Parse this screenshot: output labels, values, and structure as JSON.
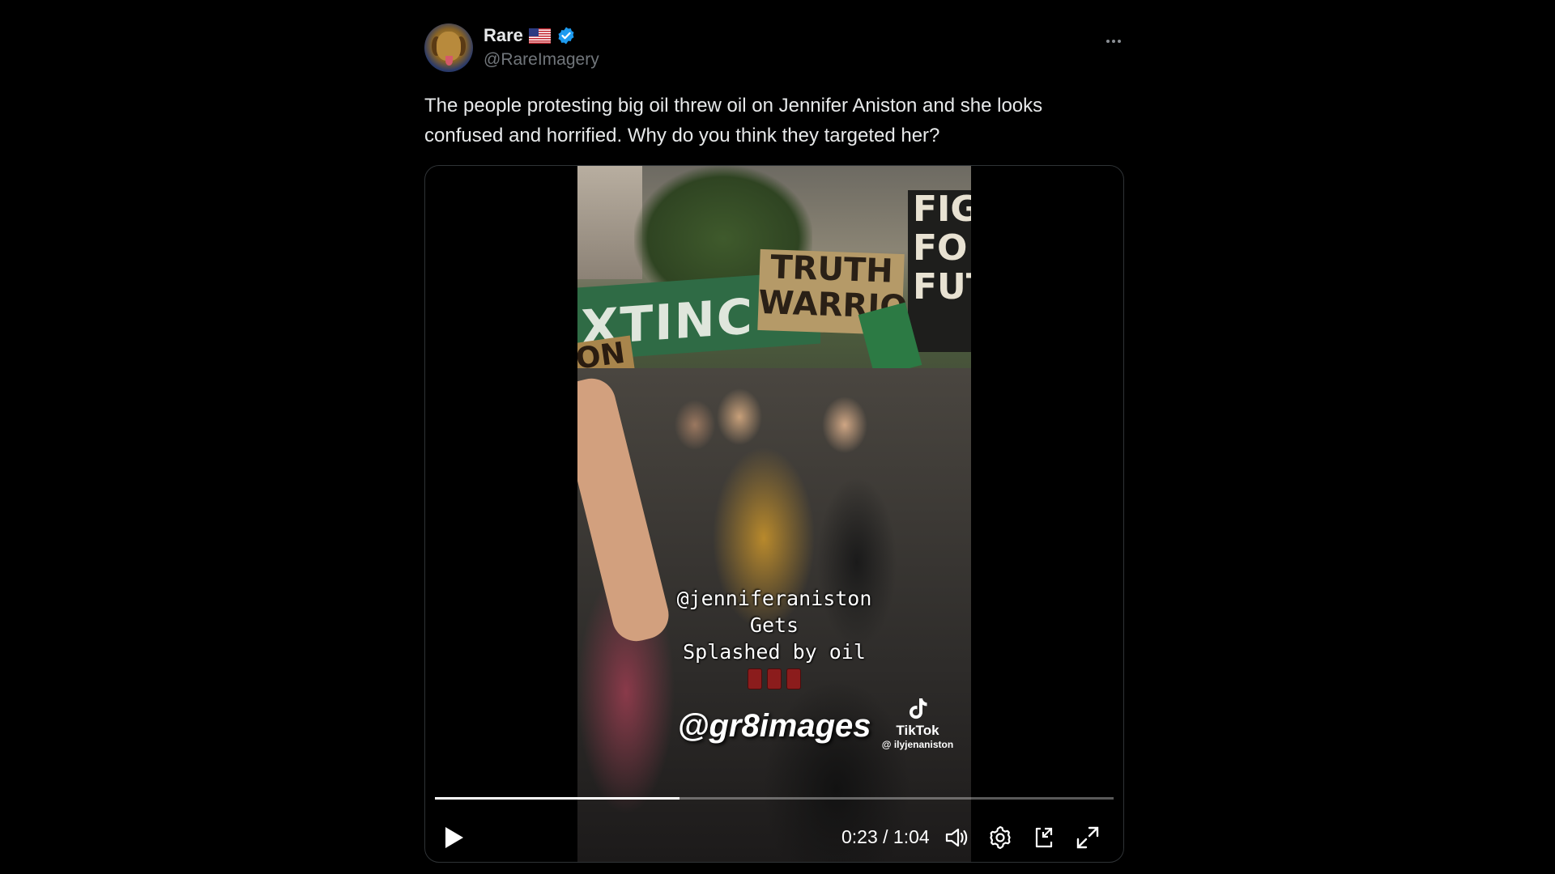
{
  "tweet": {
    "author": {
      "display_name": "Rare",
      "handle": "@RareImagery",
      "flag_icon": "us-flag-icon",
      "verified_icon": "verified-badge-icon",
      "verified_color": "#1d9bf0"
    },
    "text": "The people protesting big oil threw oil on Jennifer Aniston and she looks confused and horrified. Why do you think they targeted her?",
    "more_icon": "more-options-icon"
  },
  "video": {
    "sign_truth": "TRUTH\nWARRIO",
    "sign_fight": "FIGH\nFO\nFUT",
    "banner_text": "XTINC",
    "sign_small": "ON",
    "caption_line1": "@jenniferaniston",
    "caption_line2": "Gets",
    "caption_line3": "Splashed by oil",
    "watermark": "@gr8images",
    "tiktok_label": "TikTok",
    "tiktok_handle": "@ ilyjenaniston",
    "progress": 0.36,
    "time_display": "0:23 / 1:04"
  },
  "controls": {
    "play_icon": "play-icon",
    "volume_icon": "volume-icon",
    "settings_icon": "settings-gear-icon",
    "minimize_icon": "picture-in-picture-icon",
    "fullscreen_icon": "fullscreen-icon"
  }
}
